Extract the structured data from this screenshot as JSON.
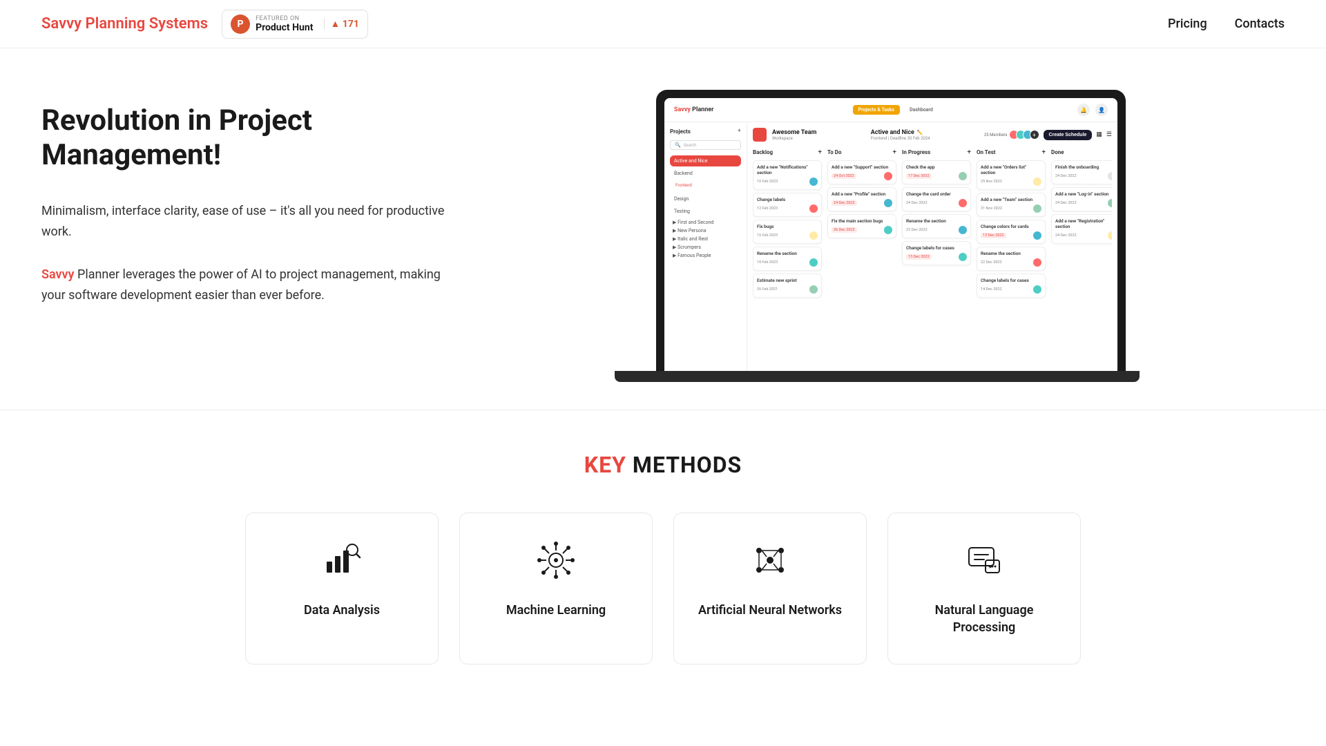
{
  "header": {
    "logo_prefix": "Savvy",
    "logo_suffix": " Planning Systems",
    "product_hunt": {
      "featured_label": "FEATURED ON",
      "name": "Product Hunt",
      "count": "171"
    },
    "nav": {
      "pricing": "Pricing",
      "contacts": "Contacts"
    }
  },
  "hero": {
    "title": "Revolution in Project Management!",
    "desc_1": "Minimalism, interface clarity, ease of use – it's all you need for productive work.",
    "desc_savvy": "Savvy",
    "desc_2": " Planner leverages the power of AI to project management, making your software development easier than ever before."
  },
  "app": {
    "logo_prefix": "Savvy",
    "logo_suffix": " Planner",
    "tabs": [
      {
        "label": "Projects & Tasks",
        "active": true
      },
      {
        "label": "Dashboard",
        "active": false
      }
    ],
    "team_name": "Awesome Team",
    "team_workspace": "Workspace",
    "project_name": "Active and Nice",
    "project_deadline": "Frontend | Deadline 20 Feb 2024",
    "members_count": "25 Members",
    "create_schedule": "Create Schedule",
    "sidebar_projects_title": "Projects",
    "sidebar_search": "Search",
    "sidebar_items": [
      {
        "label": "Active and Nice",
        "active": true
      },
      {
        "label": "Backend"
      },
      {
        "label": "Frontend",
        "tag": true
      },
      {
        "label": "Design"
      },
      {
        "label": "Testing"
      },
      {
        "label": "First and Second"
      },
      {
        "label": "New Persona"
      },
      {
        "label": "Italic and Rest"
      },
      {
        "label": "Scrumpers"
      },
      {
        "label": "Famous People"
      }
    ],
    "columns": [
      {
        "title": "Backlog",
        "items": [
          {
            "title": "Add a new \"Notifications\" section",
            "date": "10 Feb 2023"
          },
          {
            "title": "Change labels",
            "date": "12 Feb 2023"
          },
          {
            "title": "Fix bugs",
            "date": "16 Feb 2023"
          },
          {
            "title": "Rename the section",
            "date": "18 Feb 2023"
          },
          {
            "title": "Estimate new sprint",
            "date": "26 Feb 2021"
          }
        ]
      },
      {
        "title": "To Do",
        "items": [
          {
            "title": "Add a new \"Support\" section",
            "date": "24 Oct 2022",
            "date_red": true
          },
          {
            "title": "Add a new \"Profile\" section",
            "date": "24 Dec 2022",
            "date_red": true
          },
          {
            "title": "Fix the main section bugs",
            "date": "26 Dec 2022",
            "date_red": true
          }
        ]
      },
      {
        "title": "In Progress",
        "items": [
          {
            "title": "Check the app",
            "date": "17 Dec 2022",
            "date_red": true
          },
          {
            "title": "Change the card order",
            "date": "24 Dec 2022"
          },
          {
            "title": "Rename the section",
            "date": "22 Dec 2022"
          },
          {
            "title": "Change labels for cases",
            "date": "13 Dec 2022",
            "date_red": true
          }
        ]
      },
      {
        "title": "On Test",
        "items": [
          {
            "title": "Add a new \"Orders list\" section",
            "date": "25 Nov 2022"
          },
          {
            "title": "Add a new \"Team\" section",
            "date": "31 Nov 2022"
          },
          {
            "title": "Change colors for cards",
            "date": "13 Dec 2022",
            "date_red": true
          },
          {
            "title": "Rename the section",
            "date": "22 Dec 2022"
          },
          {
            "title": "Change labels for cases",
            "date": "14 Dec 2022"
          }
        ]
      },
      {
        "title": "Done",
        "items": [
          {
            "title": "Finish the onboarding",
            "date": "24 Dec 2022"
          },
          {
            "title": "Add a new \"Log-in\" section",
            "date": "24 Dec 2022"
          },
          {
            "title": "Add a new \"Registration\" section",
            "date": "24 Dec 2022"
          }
        ]
      }
    ]
  },
  "key_methods": {
    "title_key": "KEY",
    "title_rest": " METHODS",
    "cards": [
      {
        "icon": "📊",
        "name": "Data Analysis",
        "icon_type": "chart"
      },
      {
        "icon": "🧠",
        "name": "Machine Learning",
        "icon_type": "brain"
      },
      {
        "icon": "🔗",
        "name": "Artificial Neural Networks",
        "icon_type": "network"
      },
      {
        "icon": "💬",
        "name": "Natural Language Processing",
        "icon_type": "chat"
      }
    ]
  }
}
